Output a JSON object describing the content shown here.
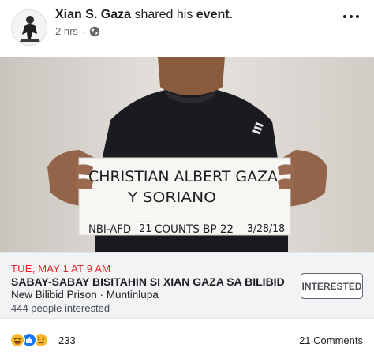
{
  "post": {
    "author": "Xian S. Gaza",
    "action_text": " shared his ",
    "object_text": "event",
    "object_suffix": ".",
    "timestamp": "2 hrs",
    "separator": "·",
    "privacy_icon": "globe-icon",
    "more_icon": "more-options-icon"
  },
  "photo": {
    "sign_line1": "CHRISTIAN ALBERT GAZA",
    "sign_line2": "Y SORIANO",
    "sign_line3a": "NBI-AFD",
    "sign_line3_count": "21",
    "sign_line3b": "COUNTS BP 22",
    "sign_date": "3/28/18"
  },
  "event": {
    "date": "TUE, MAY 1 AT 9 AM",
    "title": "SABAY-SABAY BISITAHIN SI XIAN GAZA SA BILIBID",
    "location": "New Bilibid Prison · Muntinlupa",
    "interested_count": "444 people interested",
    "interested_button": "INTERESTED"
  },
  "reactions": {
    "icons": [
      "haha-icon",
      "like-icon",
      "sad-icon"
    ],
    "count": "233",
    "comments": "21 Comments"
  },
  "colors": {
    "date_red": "#e02828",
    "like_blue": "#1877f2",
    "haha_yellow": "#f7b928"
  }
}
